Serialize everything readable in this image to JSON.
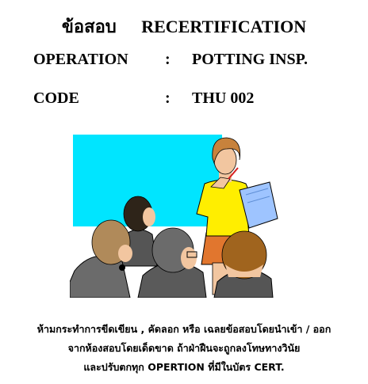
{
  "header": {
    "thai_title": "ข้อสอบ",
    "english_title": "RECERTIFICATION"
  },
  "fields": {
    "operation": {
      "label": "OPERATION",
      "separator": ":",
      "value": "POTTING INSP."
    },
    "code": {
      "label": "CODE",
      "separator": ":",
      "value": "THU 002"
    }
  },
  "illustration": {
    "icon": "presenter-with-audience-clipart",
    "colors": {
      "board": "#00e5ff",
      "presenter_shirt": "#ffee00",
      "presenter_skirt": "#e1762e",
      "audience_suits": "#555555"
    }
  },
  "notice": {
    "line1": "ห้ามกระทำการขีดเขียน , คัดลอก หรือ เฉลยข้อสอบโดยนำเข้า / ออก",
    "line2": "จากห้องสอบโดยเด็ดขาด ถ้าฝ่าฝืนจะถูกลงโทษทางวินัย",
    "line3": "และปรับตกทุก OPERTION ที่มีในบัตร CERT."
  }
}
